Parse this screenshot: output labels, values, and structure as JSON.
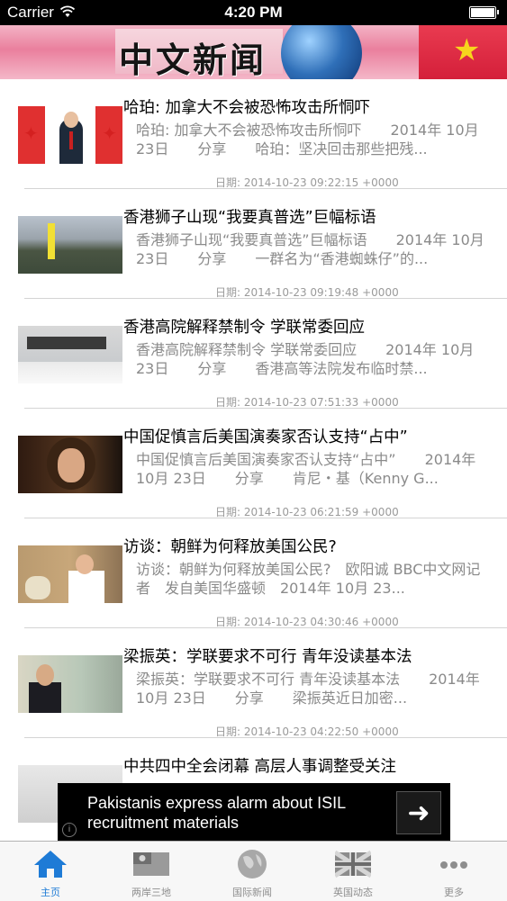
{
  "status_bar": {
    "carrier": "Carrier",
    "time": "4:20 PM"
  },
  "header": {
    "title": "中文新闻"
  },
  "news": [
    {
      "title": "哈珀: 加拿大不会被恐怖攻击所恫吓",
      "summary": "哈珀: 加拿大不会被恐怖攻击所恫吓　　2014年 10月 23日　　分享　　哈珀：坚决回击那些把残...",
      "date": "日期: 2014-10-23 09:22:15 +0000"
    },
    {
      "title": "香港狮子山现“我要真普选”巨幅标语",
      "summary": "香港狮子山现“我要真普选”巨幅标语　　2014年 10月 23日　　分享　　一群名为“香港蜘蛛仔”的...",
      "date": "日期: 2014-10-23 09:19:48 +0000"
    },
    {
      "title": "香港高院解释禁制令 学联常委回应",
      "summary": "香港高院解释禁制令 学联常委回应　　2014年 10月 23日　　分享　　香港高等法院发布临时禁...",
      "date": "日期: 2014-10-23 07:51:33 +0000"
    },
    {
      "title": "中国促慎言后美国演奏家否认支持“占中”",
      "summary": "中国促慎言后美国演奏家否认支持“占中”　　2014年 10月 23日　　分享　　肯尼・基（Kenny G...",
      "date": "日期: 2014-10-23 06:21:59 +0000"
    },
    {
      "title": "访谈：朝鲜为何释放美国公民?",
      "summary": "访谈：朝鲜为何释放美国公民?　欧阳诚 BBC中文网记者　发自美国华盛顿　2014年 10月 23...",
      "date": "日期: 2014-10-23 04:30:46 +0000"
    },
    {
      "title": "梁振英：学联要求不可行 青年没读基本法",
      "summary": "梁振英：学联要求不可行 青年没读基本法　　2014年 10月 23日　　分享　　梁振英近日加密...",
      "date": "日期: 2014-10-23 04:22:50 +0000"
    },
    {
      "title": "中共四中全会闭幕 高层人事调整受关注",
      "summary": "",
      "date": ""
    }
  ],
  "ad": {
    "text": "Pakistanis express alarm about ISIL recruitment materials",
    "arrow_icon": "arrow-right-icon",
    "info_glyph": "i"
  },
  "tabs": [
    {
      "label": "主页",
      "icon": "home-icon",
      "active": true
    },
    {
      "label": "两岸三地",
      "icon": "taiwan-flag-icon",
      "active": false
    },
    {
      "label": "国际新闻",
      "icon": "globe-icon",
      "active": false
    },
    {
      "label": "英国动态",
      "icon": "uk-flag-icon",
      "active": false
    },
    {
      "label": "更多",
      "icon": "more-icon",
      "active": false
    }
  ],
  "colors": {
    "tab_active": "#1e7bd6",
    "tab_inactive": "#8e8e8e",
    "summary_text": "#8a8a8a",
    "header_pink": "#ea7f9d"
  }
}
